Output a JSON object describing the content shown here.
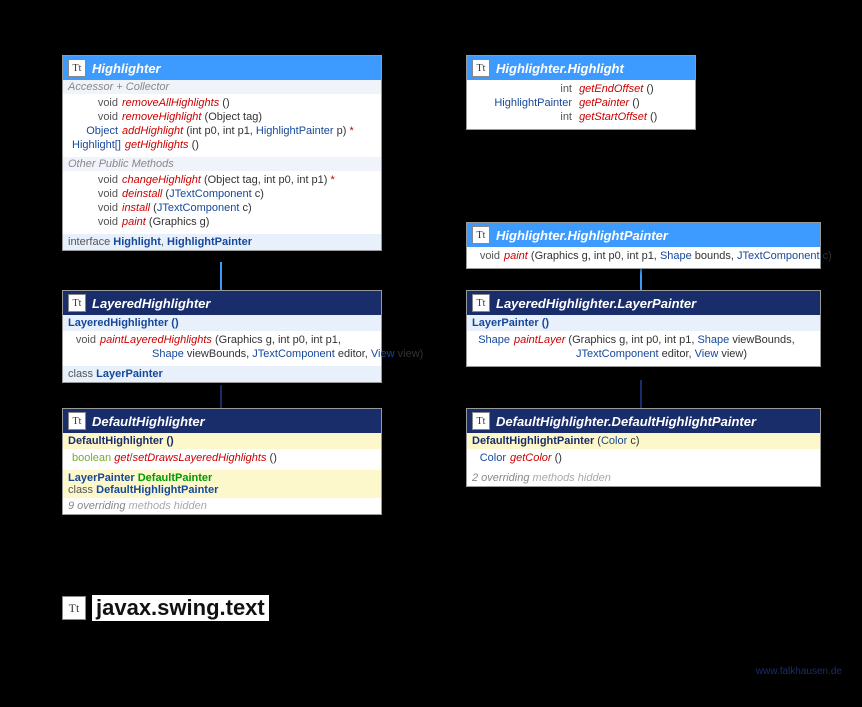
{
  "package": "javax.swing.text",
  "watermark": "www.falkhausen.de",
  "boxes": {
    "highlighter": {
      "title": "Highlighter",
      "section1_label": "Accessor + Collector",
      "methods1": [
        {
          "ret": "void",
          "name": "removeAllHighlights",
          "params": "()",
          "color": "red"
        },
        {
          "ret": "void",
          "name": "removeHighlight",
          "params": "(Object tag)",
          "color": "red"
        },
        {
          "ret": "Object",
          "name": "addHighlight",
          "params": "(int p0, int p1, HighlightPainter p)",
          "color": "red",
          "star": "*",
          "retType": "type"
        },
        {
          "ret": "Highlight[]",
          "name": "getHighlights",
          "params": "()",
          "color": "red",
          "retType": "type"
        }
      ],
      "section2_label": "Other Public Methods",
      "methods2": [
        {
          "ret": "void",
          "name": "changeHighlight",
          "params": "(Object tag, int p0, int p1)",
          "color": "red",
          "star": "*"
        },
        {
          "ret": "void",
          "name": "deinstall",
          "params": "(JTextComponent c)",
          "color": "red"
        },
        {
          "ret": "void",
          "name": "install",
          "params": "(JTextComponent c)",
          "color": "red"
        },
        {
          "ret": "void",
          "name": "paint",
          "params": "(Graphics g)",
          "color": "red"
        }
      ],
      "footer": "interface Highlight, HighlightPainter"
    },
    "highlight": {
      "title": "Highlighter.Highlight",
      "methods": [
        {
          "ret": "int",
          "name": "getEndOffset",
          "params": "()",
          "color": "red"
        },
        {
          "ret": "HighlightPainter",
          "name": "getPainter",
          "params": "()",
          "color": "red",
          "retType": "type"
        },
        {
          "ret": "int",
          "name": "getStartOffset",
          "params": "()",
          "color": "red"
        }
      ]
    },
    "highlightPainter": {
      "title": "Highlighter.HighlightPainter",
      "methods": [
        {
          "ret": "void",
          "name": "paint",
          "params": "(Graphics g, int p0, int p1, Shape bounds, JTextComponent c)",
          "color": "red"
        }
      ]
    },
    "layeredHighlighter": {
      "title": "LayeredHighlighter",
      "constructor": "LayeredHighlighter ()",
      "methods": [
        {
          "ret": "void",
          "name": "paintLayeredHighlights",
          "params": "(Graphics g, int p0, int p1,",
          "color": "red"
        },
        {
          "ret": "",
          "name": "",
          "params": "Shape viewBounds, JTextComponent editor, View view)",
          "color": "none",
          "cont": true
        }
      ],
      "footer": "class LayerPainter"
    },
    "layerPainter": {
      "title": "LayeredHighlighter.LayerPainter",
      "constructor": "LayerPainter ()",
      "methods": [
        {
          "ret": "Shape",
          "name": "paintLayer",
          "params": "(Graphics g, int p0, int p1, Shape viewBounds,",
          "color": "red",
          "retType": "type"
        },
        {
          "ret": "",
          "name": "",
          "params": "JTextComponent editor, View view)",
          "color": "none",
          "cont": true
        }
      ]
    },
    "defaultHighlighter": {
      "title": "DefaultHighlighter",
      "constructor": "DefaultHighlighter ()",
      "methods": [
        {
          "ret": "boolean",
          "name": "get/setDrawsLayeredHighlights",
          "params": "()",
          "color": "red",
          "retType": "kw"
        }
      ],
      "footer1_type": "LayerPainter",
      "footer1_name": "DefaultPainter",
      "footer2_kw": "class",
      "footer2_name": "DefaultHighlightPainter",
      "hidden": "9 overriding methods hidden"
    },
    "defaultHighlightPainter": {
      "title": "DefaultHighlighter.DefaultHighlightPainter",
      "constructor": "DefaultHighlightPainter (Color c)",
      "methods": [
        {
          "ret": "Color",
          "name": "getColor",
          "params": "()",
          "color": "red",
          "retType": "type"
        }
      ],
      "hidden": "2 overriding methods hidden"
    }
  }
}
